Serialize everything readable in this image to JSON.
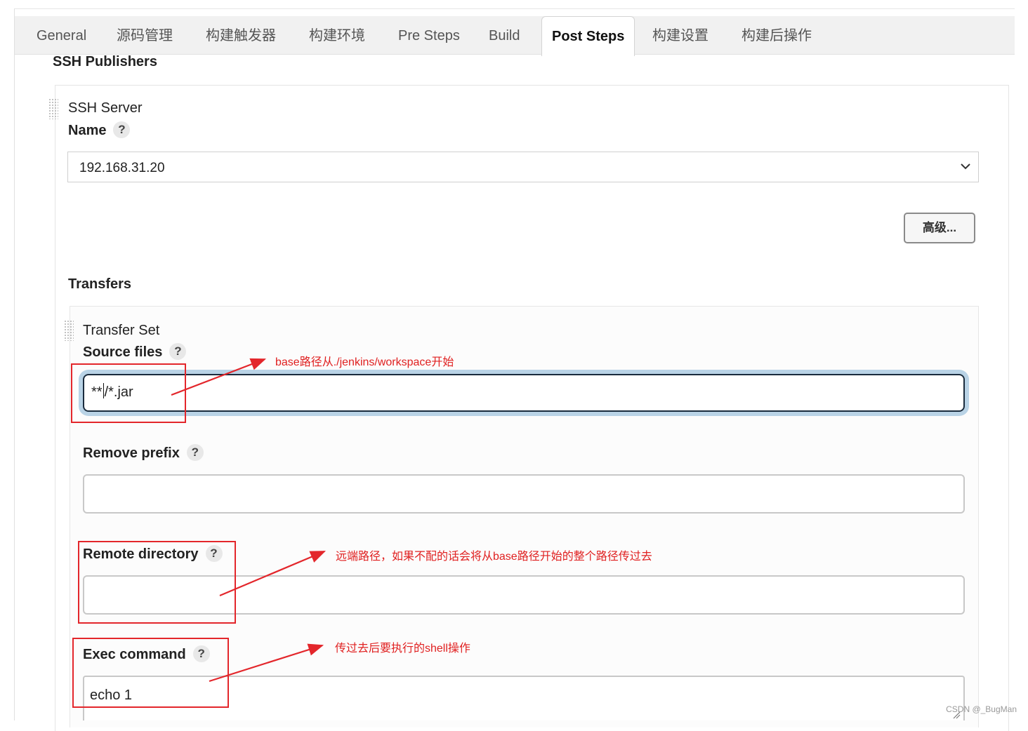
{
  "tabs": [
    {
      "label": "General"
    },
    {
      "label": "源码管理"
    },
    {
      "label": "构建触发器"
    },
    {
      "label": "构建环境"
    },
    {
      "label": "Pre Steps"
    },
    {
      "label": "Build"
    },
    {
      "label": "Post Steps",
      "active": true
    },
    {
      "label": "构建设置"
    },
    {
      "label": "构建后操作"
    }
  ],
  "publishers": {
    "title": "SSH Publishers",
    "server_section": "SSH Server",
    "name_label": "Name",
    "help_glyph": "?",
    "name_value": "192.168.31.20",
    "advanced_label": "高级..."
  },
  "transfers": {
    "title": "Transfers",
    "set_title": "Transfer Set",
    "source_files_label": "Source files",
    "source_files_value_a": "**",
    "source_files_value_b": "/*.jar",
    "remove_prefix_label": "Remove prefix",
    "remove_prefix_value": "",
    "remote_directory_label": "Remote directory",
    "remote_directory_value": "",
    "exec_command_label": "Exec command",
    "exec_command_value": "echo 1"
  },
  "annotations": {
    "source_note": "base路径从./jenkins/workspace开始",
    "remote_note": "远端路径，如果不配的话会将从base路径开始的整个路径传过去",
    "exec_note": "传过去后要执行的shell操作",
    "color": "#e3262b"
  },
  "watermark": "CSDN @_BugMan",
  "colors": {
    "focus_border": "#1a2b3d",
    "focus_glow": "#b9d3e6",
    "tabbar_bg": "#f1f1f1"
  }
}
